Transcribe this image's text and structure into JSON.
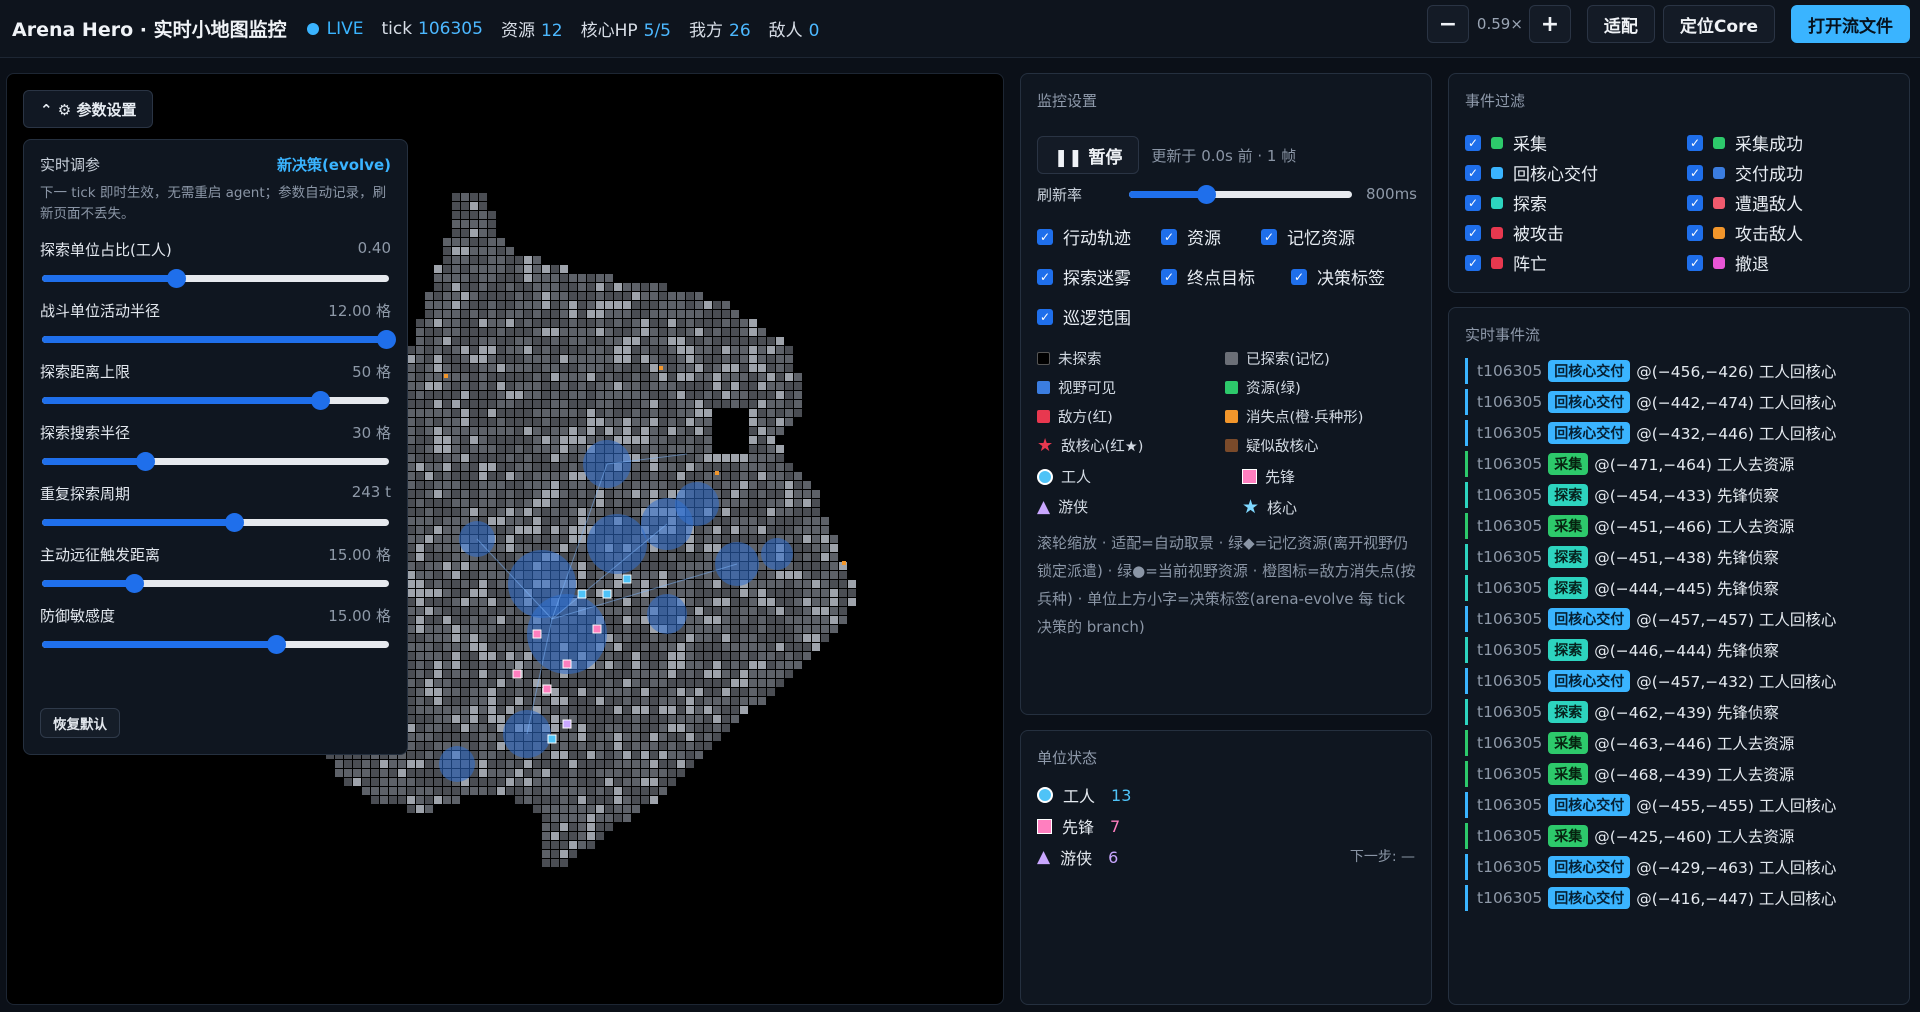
{
  "header": {
    "title": "Arena Hero · 实时小地图监控",
    "live": "LIVE",
    "tick_label": "tick",
    "tick_value": "106305",
    "resource_label": "资源",
    "resource_value": "12",
    "core_hp_label": "核心HP",
    "core_hp_value": "5/5",
    "ally_label": "我方",
    "ally_value": "26",
    "enemy_label": "敌人",
    "enemy_value": "0",
    "zoom_out": "−",
    "zoom_value": "0.59×",
    "zoom_in": "+",
    "fit": "适配",
    "locate_core": "定位Core",
    "open_file": "打开流文件"
  },
  "params": {
    "toggle_label": "⌃ ⚙ 参数设置",
    "title": "实时调参",
    "link": "新决策(evolve)",
    "desc": "下一 tick 即时生效，无需重启 agent；参数自动记录，刷新页面不丢失。",
    "sliders": [
      {
        "label": "探索单位占比(工人)",
        "value": "0.40",
        "fraction": 0.39
      },
      {
        "label": "战斗单位活动半径",
        "value": "12.00 格",
        "fraction": 1.0
      },
      {
        "label": "探索距离上限",
        "value": "50 格",
        "fraction": 0.81
      },
      {
        "label": "探索搜索半径",
        "value": "30 格",
        "fraction": 0.3
      },
      {
        "label": "重复探索周期",
        "value": "243 t",
        "fraction": 0.56
      },
      {
        "label": "主动远征触发距离",
        "value": "15.00 格",
        "fraction": 0.27
      },
      {
        "label": "防御敏感度",
        "value": "15.00 格",
        "fraction": 0.68
      }
    ],
    "reset": "恢复默认"
  },
  "monitor": {
    "title": "监控设置",
    "pause": "❚❚ 暂停",
    "updated": "更新于 0.0s 前 · 1 帧",
    "rate_label": "刷新率",
    "rate_value": "800ms",
    "rate_fraction": 0.35,
    "checks": [
      "行动轨迹",
      "资源",
      "记忆资源",
      "探索迷雾",
      "终点目标",
      "决策标签",
      "巡逻范围"
    ],
    "legend": [
      {
        "label": "未探索",
        "color": "#000000"
      },
      {
        "label": "已探索(记忆)",
        "color": "#6b6f77"
      },
      {
        "label": "视野可见",
        "color": "#3b7de0"
      },
      {
        "label": "资源(绿)",
        "color": "#2dc96b"
      },
      {
        "label": "敌方(红)",
        "color": "#e8384f"
      },
      {
        "label": "消失点(橙·兵种形)",
        "color": "#f2962b"
      },
      {
        "label": "敌核心(红★)",
        "color": "#e8384f"
      },
      {
        "label": "疑似敌核心",
        "color": "#7a4a2a"
      }
    ],
    "units": [
      {
        "label": "工人",
        "icon": "circle-icon",
        "color": "#4fc3f7"
      },
      {
        "label": "先锋",
        "icon": "square-icon",
        "color": "#ff7fbf"
      },
      {
        "label": "游侠",
        "icon": "triangle-icon",
        "color": "#c9a7ff"
      },
      {
        "label": "核心",
        "icon": "star-icon",
        "color": "#7fd8ff"
      }
    ],
    "help": "滚轮缩放 · 适配=自动取景 · 绿◆=记忆资源(离开视野仍锁定派遣) · 绿●=当前视野资源 · 橙图标=敌方消失点(按兵种) · 单位上方小字=决策标签(arena-evolve 每 tick 决策的 branch)"
  },
  "unit_status": {
    "title": "单位状态",
    "rows": [
      {
        "label": "工人",
        "count": "13",
        "color": "#4fc3f7"
      },
      {
        "label": "先锋",
        "count": "7",
        "color": "#ff7fbf"
      },
      {
        "label": "游侠",
        "count": "6",
        "color": "#c9a7ff"
      }
    ],
    "next": "下一步: —"
  },
  "event_filter": {
    "title": "事件过滤",
    "items": [
      {
        "label": "采集",
        "color": "#2dc96b"
      },
      {
        "label": "采集成功",
        "color": "#2dc96b"
      },
      {
        "label": "回核心交付",
        "color": "#3ab4ff"
      },
      {
        "label": "交付成功",
        "color": "#3b7de0"
      },
      {
        "label": "探索",
        "color": "#2dd4bf"
      },
      {
        "label": "遭遇敌人",
        "color": "#f05a6e"
      },
      {
        "label": "被攻击",
        "color": "#e8384f"
      },
      {
        "label": "攻击敌人",
        "color": "#f2962b"
      },
      {
        "label": "阵亡",
        "color": "#e8384f"
      },
      {
        "label": "撤退",
        "color": "#e855d6"
      }
    ]
  },
  "event_stream": {
    "title": "实时事件流",
    "events": [
      {
        "tick": "t106305",
        "tag": "回核心交付",
        "kind": "deliver",
        "text": "@(−456,−426) 工人回核心"
      },
      {
        "tick": "t106305",
        "tag": "回核心交付",
        "kind": "deliver",
        "text": "@(−442,−474) 工人回核心"
      },
      {
        "tick": "t106305",
        "tag": "回核心交付",
        "kind": "deliver",
        "text": "@(−432,−446) 工人回核心"
      },
      {
        "tick": "t106305",
        "tag": "采集",
        "kind": "gather",
        "text": "@(−471,−464) 工人去资源"
      },
      {
        "tick": "t106305",
        "tag": "探索",
        "kind": "explore",
        "text": "@(−454,−433) 先锋侦察"
      },
      {
        "tick": "t106305",
        "tag": "采集",
        "kind": "gather",
        "text": "@(−451,−466) 工人去资源"
      },
      {
        "tick": "t106305",
        "tag": "探索",
        "kind": "explore",
        "text": "@(−451,−438) 先锋侦察"
      },
      {
        "tick": "t106305",
        "tag": "探索",
        "kind": "explore",
        "text": "@(−444,−445) 先锋侦察"
      },
      {
        "tick": "t106305",
        "tag": "回核心交付",
        "kind": "deliver",
        "text": "@(−457,−457) 工人回核心"
      },
      {
        "tick": "t106305",
        "tag": "探索",
        "kind": "explore",
        "text": "@(−446,−444) 先锋侦察"
      },
      {
        "tick": "t106305",
        "tag": "回核心交付",
        "kind": "deliver",
        "text": "@(−457,−432) 工人回核心"
      },
      {
        "tick": "t106305",
        "tag": "探索",
        "kind": "explore",
        "text": "@(−462,−439) 先锋侦察"
      },
      {
        "tick": "t106305",
        "tag": "采集",
        "kind": "gather",
        "text": "@(−463,−446) 工人去资源"
      },
      {
        "tick": "t106305",
        "tag": "采集",
        "kind": "gather",
        "text": "@(−468,−439) 工人去资源"
      },
      {
        "tick": "t106305",
        "tag": "回核心交付",
        "kind": "deliver",
        "text": "@(−455,−455) 工人回核心"
      },
      {
        "tick": "t106305",
        "tag": "采集",
        "kind": "gather",
        "text": "@(−425,−460) 工人去资源"
      },
      {
        "tick": "t106305",
        "tag": "回核心交付",
        "kind": "deliver",
        "text": "@(−429,−463) 工人回核心"
      },
      {
        "tick": "t106305",
        "tag": "回核心交付",
        "kind": "deliver",
        "text": "@(−416,−447) 工人回核心"
      }
    ]
  },
  "colors": {
    "accent": "#3ab4ff",
    "slider": "#1f6feb",
    "deliver": "#3ab4ff",
    "gather": "#2dc96b",
    "explore": "#2dd4bf"
  }
}
